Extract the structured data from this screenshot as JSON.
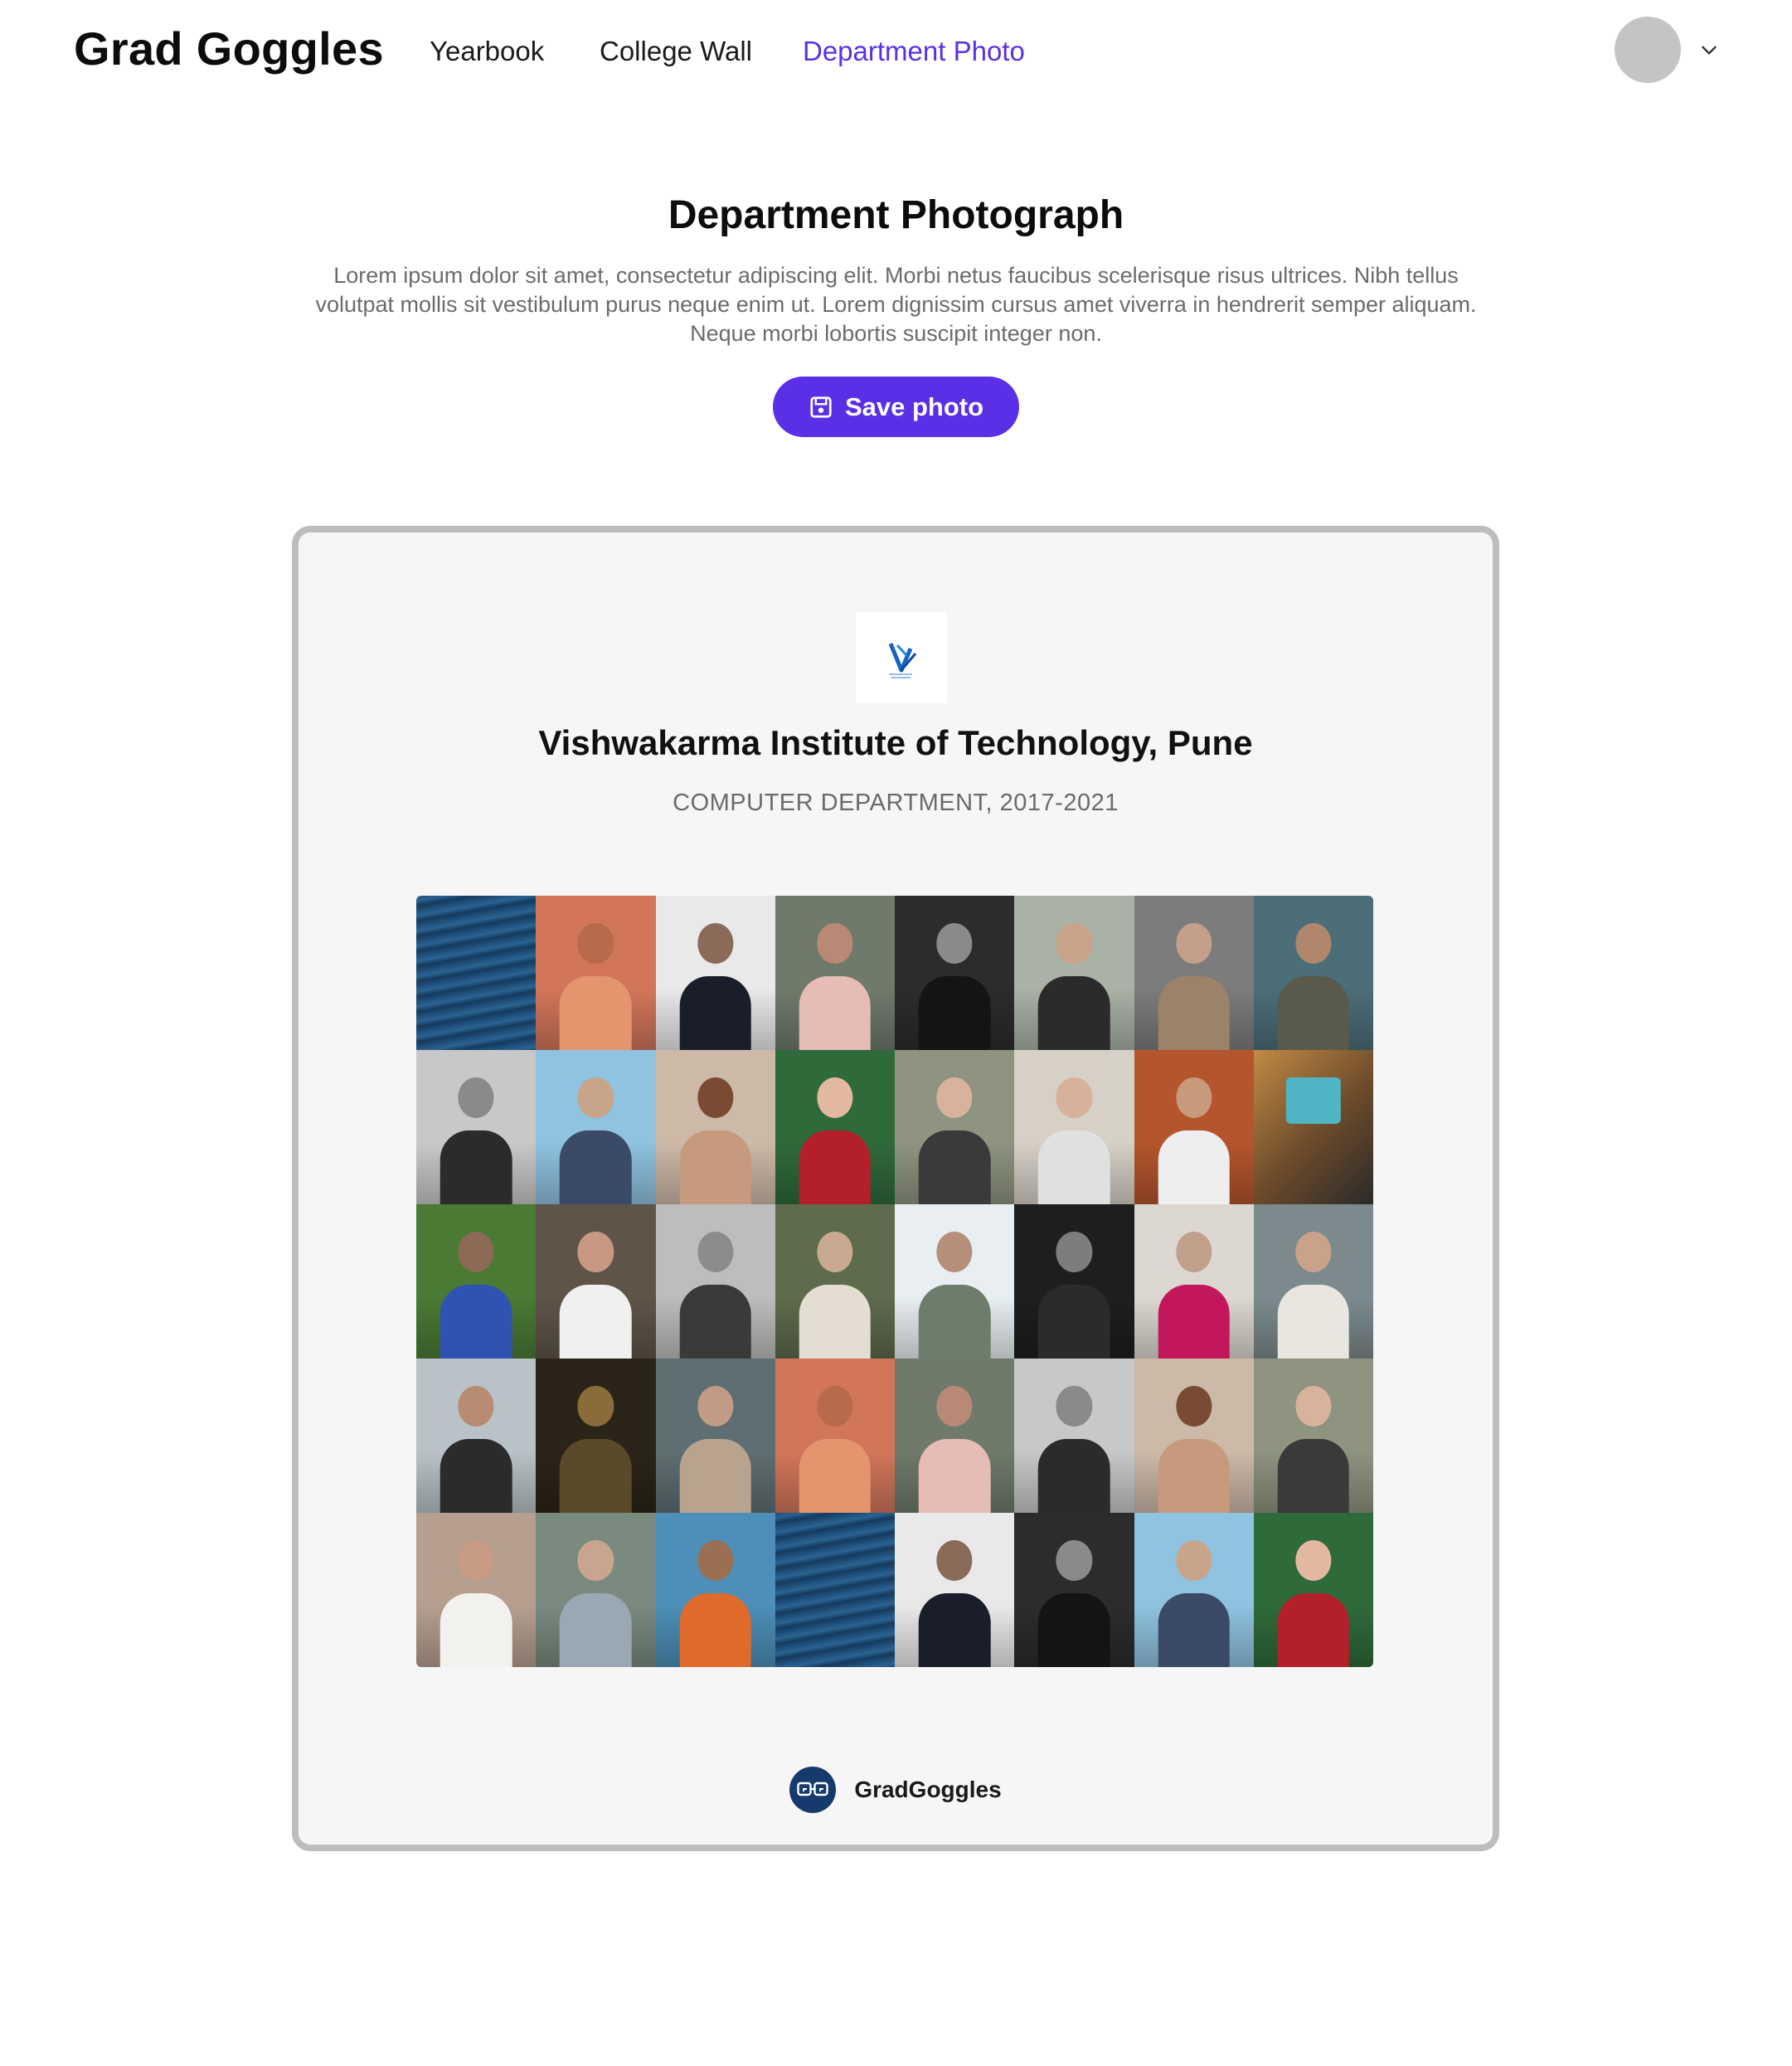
{
  "header": {
    "brand": "Grad Goggles",
    "nav": [
      {
        "label": "Yearbook",
        "active": false
      },
      {
        "label": "College Wall",
        "active": false
      },
      {
        "label": "Department Photo",
        "active": true
      }
    ],
    "avatar_icon": "user-avatar",
    "menu_icon": "chevron-down-icon"
  },
  "intro": {
    "title": "Department Photograph",
    "description": "Lorem ipsum dolor sit amet, consectetur adipiscing elit. Morbi netus faucibus scelerisque risus ultrices. Nibh tellus volutpat mollis sit vestibulum purus neque enim ut. Lorem dignissim cursus amet viverra in hendrerit semper aliquam. Neque morbi lobortis suscipit integer non.",
    "save_label": "Save photo",
    "save_icon": "save-icon"
  },
  "card": {
    "institute_logo": "vit-logo",
    "institute_name": "Vishwakarma Institute of Technology, Pune",
    "department": "COMPUTER DEPARTMENT, 2017-2021",
    "footer_brand": "GradGoggles",
    "footer_icon": "gradgoggles-logo-icon"
  },
  "colors": {
    "accent": "#5a2fe6",
    "card_border": "#bdbdbd",
    "card_bg": "#f6f6f6",
    "badge": "#163a6b"
  },
  "photo_grid": {
    "rows": 5,
    "columns": 8,
    "tiles": [
      {
        "bg": "#1f4f7a",
        "kind": "sea"
      },
      {
        "bg": "#d2765a",
        "kind": "person",
        "skin": "#b86a4c",
        "cloth": "#e4956e"
      },
      {
        "bg": "#e9e9e9",
        "kind": "person",
        "skin": "#8a6a58",
        "cloth": "#1a1e2a"
      },
      {
        "bg": "#6f7a6b",
        "kind": "person",
        "skin": "#b88a76",
        "cloth": "#e6bcb6"
      },
      {
        "bg": "#2c2c2c",
        "kind": "person",
        "skin": "#8a8a8a",
        "cloth": "#141414"
      },
      {
        "bg": "#a9b2a4",
        "kind": "person",
        "skin": "#c9a48b",
        "cloth": "#2b2b2b"
      },
      {
        "bg": "#7c7c7c",
        "kind": "person",
        "skin": "#c4a08a",
        "cloth": "#9b8269"
      },
      {
        "bg": "#4b6e78",
        "kind": "person",
        "skin": "#b0876d",
        "cloth": "#5a5a4c"
      },
      {
        "bg": "#c8c8c8",
        "kind": "person",
        "skin": "#8a8a8a",
        "cloth": "#2b2b2b"
      },
      {
        "bg": "#8fc3e0",
        "kind": "person",
        "skin": "#c8a58a",
        "cloth": "#3b4a66"
      },
      {
        "bg": "#cdb9a8",
        "kind": "person",
        "skin": "#7a4b33",
        "cloth": "#c79a7e"
      },
      {
        "bg": "#2f6a3a",
        "kind": "person",
        "skin": "#e2b9a0",
        "cloth": "#b3202a"
      },
      {
        "bg": "#8e9480",
        "kind": "person",
        "skin": "#d9b29c",
        "cloth": "#3a3a3a"
      },
      {
        "bg": "#d6d0c6",
        "kind": "person",
        "skin": "#d7b19a",
        "cloth": "#e0e0e0"
      },
      {
        "bg": "#b4552d",
        "kind": "person",
        "skin": "#c89a7c",
        "cloth": "#eeeeee"
      },
      {
        "bg": "#c18a45",
        "kind": "abstract",
        "skin": "#2a2a2a",
        "cloth": "#4fb5c5"
      },
      {
        "bg": "#4b7a35",
        "kind": "person",
        "skin": "#8d6a55",
        "cloth": "#2f53b3"
      },
      {
        "bg": "#5f5448",
        "kind": "person",
        "skin": "#c99882",
        "cloth": "#f0f0f0"
      },
      {
        "bg": "#bdbdbd",
        "kind": "person",
        "skin": "#8c8c8c",
        "cloth": "#3a3a3a"
      },
      {
        "bg": "#5e6b4c",
        "kind": "person",
        "skin": "#caa993",
        "cloth": "#e3ddd3"
      },
      {
        "bg": "#e8eef2",
        "kind": "person",
        "skin": "#b58f7a",
        "cloth": "#6e7d6b"
      },
      {
        "bg": "#1e1e1e",
        "kind": "person",
        "skin": "#7d7d7d",
        "cloth": "#2b2b2b"
      },
      {
        "bg": "#dcd7d0",
        "kind": "person",
        "skin": "#c0a08b",
        "cloth": "#c2185b"
      },
      {
        "bg": "#7c8a8e",
        "kind": "person",
        "skin": "#caa28a",
        "cloth": "#e8e6df"
      },
      {
        "bg": "#b9c2c7",
        "kind": "person",
        "skin": "#b78c72",
        "cloth": "#2b2b2b"
      },
      {
        "bg": "#2b2418",
        "kind": "person",
        "skin": "#8a6b3a",
        "cloth": "#5a4a2a"
      },
      {
        "bg": "#5f6e72",
        "kind": "person",
        "skin": "#c19b86",
        "cloth": "#b8a48e"
      },
      {
        "bg": "#d2765a",
        "kind": "person",
        "skin": "#b86a4c",
        "cloth": "#e4956e"
      },
      {
        "bg": "#6f7a6b",
        "kind": "person",
        "skin": "#b88a76",
        "cloth": "#e6bcb6"
      },
      {
        "bg": "#c8c8c8",
        "kind": "person",
        "skin": "#8a8a8a",
        "cloth": "#2b2b2b"
      },
      {
        "bg": "#cdb9a8",
        "kind": "person",
        "skin": "#7a4b33",
        "cloth": "#c79a7e"
      },
      {
        "bg": "#8e9480",
        "kind": "person",
        "skin": "#d9b29c",
        "cloth": "#3a3a3a"
      },
      {
        "bg": "#b69f8f",
        "kind": "person",
        "skin": "#c89b84",
        "cloth": "#f3f1ee"
      },
      {
        "bg": "#7a8a7e",
        "kind": "person",
        "skin": "#c9a58f",
        "cloth": "#9aa8b3"
      },
      {
        "bg": "#4d8fb8",
        "kind": "person",
        "skin": "#9a6f52",
        "cloth": "#e06a2a"
      },
      {
        "bg": "#1f4f7a",
        "kind": "sea"
      },
      {
        "bg": "#e9e9e9",
        "kind": "person",
        "skin": "#8a6a58",
        "cloth": "#1a1e2a"
      },
      {
        "bg": "#2c2c2c",
        "kind": "person",
        "skin": "#8a8a8a",
        "cloth": "#141414"
      },
      {
        "bg": "#8fc3e0",
        "kind": "person",
        "skin": "#c8a58a",
        "cloth": "#3b4a66"
      },
      {
        "bg": "#2f6a3a",
        "kind": "person",
        "skin": "#e2b9a0",
        "cloth": "#b3202a"
      }
    ]
  }
}
